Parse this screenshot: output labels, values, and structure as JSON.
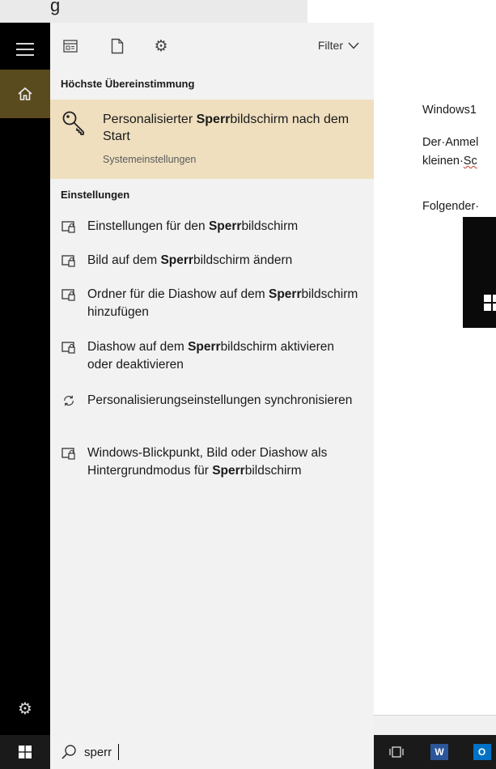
{
  "background_doc": {
    "top_strip_text": "g",
    "lines": [
      "Windows1",
      "Der·Anmel",
      "kleinen·",
      "Sc",
      "Folgender·"
    ]
  },
  "rail": {
    "icons": [
      "menu-icon",
      "home-icon",
      "settings-icon"
    ]
  },
  "toolbar": {
    "icons": [
      "apps-icon",
      "documents-icon",
      "settings-icon"
    ],
    "filter_label": "Filter"
  },
  "sections": {
    "best_match_label": "Höchste Übereinstimmung",
    "settings_label": "Einstellungen"
  },
  "best_match": {
    "title_pre": "Personalisierter ",
    "title_bold": "Sperr",
    "title_post": "bildschirm nach dem Start",
    "subtitle": "Systemeinstellungen",
    "icon": "key-icon"
  },
  "results": [
    {
      "icon": "lockscreen-icon",
      "pre": "Einstellungen für den ",
      "bold": "Sperr",
      "post": "bildschirm"
    },
    {
      "icon": "lockscreen-icon",
      "pre": "Bild auf dem ",
      "bold": "Sperr",
      "post": "bildschirm ändern"
    },
    {
      "icon": "lockscreen-icon",
      "pre": "Ordner für die Diashow auf dem ",
      "bold": "Sperr",
      "post": "bildschirm hinzufügen"
    },
    {
      "icon": "lockscreen-icon",
      "pre": "Diashow auf dem ",
      "bold": "Sperr",
      "post": "bildschirm aktivieren oder deaktivieren"
    },
    {
      "icon": "sync-icon",
      "pre": "Personalisierungseinstellungen synchronisieren",
      "bold": "",
      "post": ""
    },
    {
      "icon": "lockscreen-icon",
      "pre": "Windows-Blickpunkt, Bild oder Diashow als Hintergrundmodus für ",
      "bold": "Sperr",
      "post": "bildschirm"
    }
  ],
  "search": {
    "value": "sperr",
    "icon": "search-icon"
  },
  "taskbar": {
    "apps": [
      "task-view-icon",
      "word-icon",
      "outlook-icon"
    ],
    "word_letter": "W",
    "outlook_letter": "O"
  },
  "colors": {
    "rail_bg": "#000000",
    "home_active": "#5a4b1e",
    "best_match_bg": "#efdfbf",
    "panel_bg": "#f2f2f2",
    "word_blue": "#2b579a",
    "outlook_blue": "#0072c6"
  }
}
